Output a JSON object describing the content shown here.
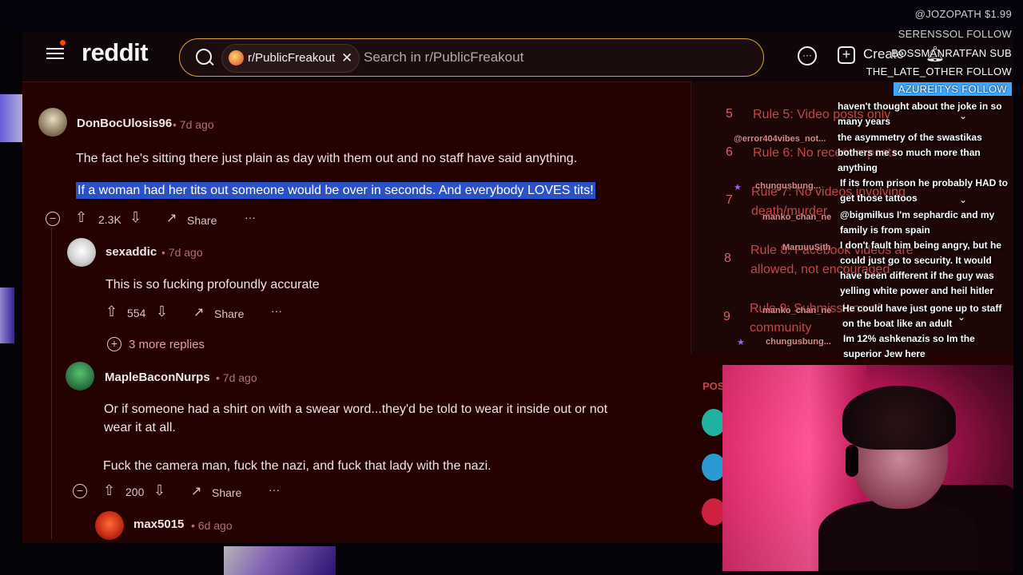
{
  "header": {
    "logo": "reddit",
    "subreddit_chip": "r/PublicFreakout",
    "search_placeholder": "Search in r/PublicFreakout",
    "create_label": "Create"
  },
  "comments": [
    {
      "username": "DonBocUlosis96",
      "time": "• 7d ago",
      "lines": [
        "The fact he's sitting there just plain as day with them out and no staff have said anything.",
        "If a woman had her tits out someone would be over in seconds. And everybody LOVES tits!"
      ],
      "votes": "2.3K",
      "share": "Share",
      "more": "···"
    },
    {
      "username": "sexaddic",
      "time": "• 7d ago",
      "lines": [
        "This is so fucking profoundly accurate"
      ],
      "votes": "554",
      "share": "Share",
      "more": "···",
      "replies": "3 more replies"
    },
    {
      "username": "MapleBaconNurps",
      "time": "• 7d ago",
      "lines": [
        "Or if someone had a shirt on with a swear word...they'd be told to wear it inside out or not",
        "wear it at all.",
        "Fuck the camera man, fuck the nazi, and fuck that lady with the nazi."
      ],
      "votes": "200",
      "share": "Share",
      "more": "···"
    },
    {
      "username": "max5015",
      "time": "• 6d ago"
    }
  ],
  "rules": [
    {
      "num": "5",
      "text": "Rule 5: Video posts only"
    },
    {
      "num": "6",
      "text": "Rule 6: No recent reposts"
    },
    {
      "num": "7",
      "text": "Rule 7: No videos involving death/murder"
    },
    {
      "num": "8",
      "text": "Rule 8: Facebook videos are allowed, not encouraged"
    },
    {
      "num": "9",
      "text": "Rule 9: Submissions of community"
    }
  ],
  "sidebar": {
    "posts_label": "POS"
  },
  "follow_overlay": [
    "@JOZOPATH $1.99",
    "SERENSSOL FOLLOW",
    "BOSSMANRATFAN SUB",
    "THE_LATE_OTHER FOLLOW",
    "AZUREITYS FOLLOW"
  ],
  "chat": [
    {
      "text": "haven't thought about the joke in so many years"
    },
    {
      "user": "@error404vibes_not...",
      "text": "the asymmetry of the swastikas bothers me so much more than anything"
    },
    {
      "user": "chungusbung...",
      "text": "If its from prison he probably HAD to get those tattoos"
    },
    {
      "user": "manko_chan_ne",
      "text": "@bigmilkus I'm sephardic and my family is from spain"
    },
    {
      "user": "MaruuuSith",
      "text": "I don't fault him being angry, but he could just go to security. It would have been different if the guy was yelling white power and heil hitler"
    },
    {
      "user": "manko_chan_ne",
      "text": "He could have just gone up to staff on the boat like an adult"
    },
    {
      "user": "chungusbung...",
      "text": "Im 12% ashkenazis so Im the superior Jew here"
    }
  ],
  "colors": {
    "background": "#240202",
    "highlight": "#2a52c8",
    "search_border": "#d8a53a",
    "rule_text": "#c04848",
    "follow_highlight": "#3aa8ff"
  }
}
